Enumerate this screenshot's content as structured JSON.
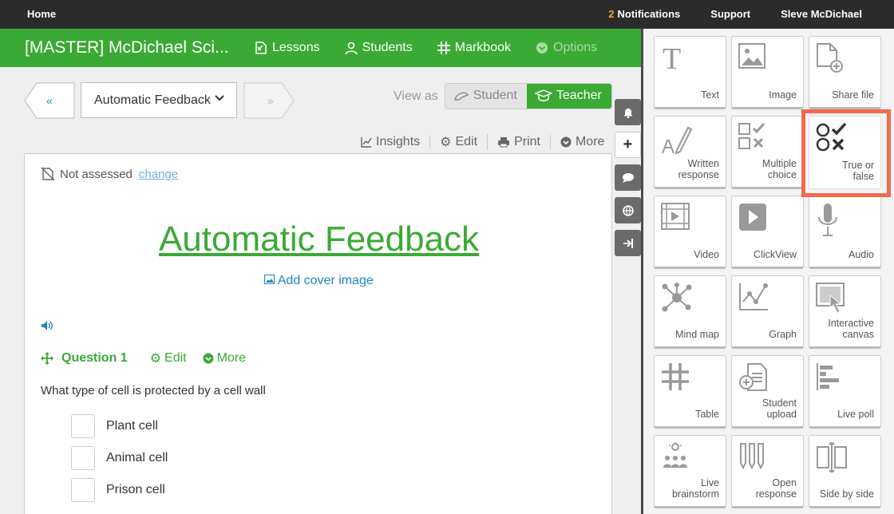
{
  "topbar": {
    "home": "Home",
    "notifications_count": "2",
    "notifications_label": "Notifications",
    "support": "Support",
    "user": "Sleve McDichael"
  },
  "course": {
    "title": "[MASTER] McDichael Sci...",
    "nav": [
      "Lessons",
      "Students",
      "Markbook",
      "Options"
    ]
  },
  "pager": {
    "prev": "«",
    "next": "»",
    "selected": "Automatic Feedback"
  },
  "view_as": {
    "label": "View as",
    "student": "Student",
    "teacher": "Teacher"
  },
  "toolbar": {
    "insights": "Insights",
    "edit": "Edit",
    "print": "Print",
    "more": "More"
  },
  "page": {
    "assessment": "Not assessed",
    "change": "change",
    "title": "Automatic Feedback",
    "cover": "Add cover image"
  },
  "question": {
    "title": "Question 1",
    "edit": "Edit",
    "more": "More",
    "text": "What type of cell is protected by a cell wall",
    "options": [
      "Plant cell",
      "Animal cell",
      "Prison cell"
    ]
  },
  "palette": {
    "tiles": [
      {
        "label": "Text",
        "icon": "text-icon"
      },
      {
        "label": "Image",
        "icon": "image-icon"
      },
      {
        "label": "Share file",
        "icon": "share-file-icon"
      },
      {
        "label": "Written response",
        "icon": "written-response-icon"
      },
      {
        "label": "Multiple choice",
        "icon": "multiple-choice-icon"
      },
      {
        "label": "True or false",
        "icon": "true-false-icon"
      },
      {
        "label": "Video",
        "icon": "video-icon"
      },
      {
        "label": "ClickView",
        "icon": "clickview-icon"
      },
      {
        "label": "Audio",
        "icon": "audio-icon"
      },
      {
        "label": "Mind map",
        "icon": "mind-map-icon"
      },
      {
        "label": "Graph",
        "icon": "graph-icon"
      },
      {
        "label": "Interactive canvas",
        "icon": "interactive-canvas-icon"
      },
      {
        "label": "Table",
        "icon": "table-icon"
      },
      {
        "label": "Student upload",
        "icon": "student-upload-icon"
      },
      {
        "label": "Live poll",
        "icon": "live-poll-icon"
      },
      {
        "label": "Live brainstorm",
        "icon": "live-brainstorm-icon"
      },
      {
        "label": "Open response",
        "icon": "open-response-icon"
      },
      {
        "label": "Side by side",
        "icon": "side-by-side-icon"
      }
    ]
  },
  "colors": {
    "brand_green": "#3aaa35",
    "link_blue": "#1f86c1",
    "highlight": "#f26a4b"
  }
}
